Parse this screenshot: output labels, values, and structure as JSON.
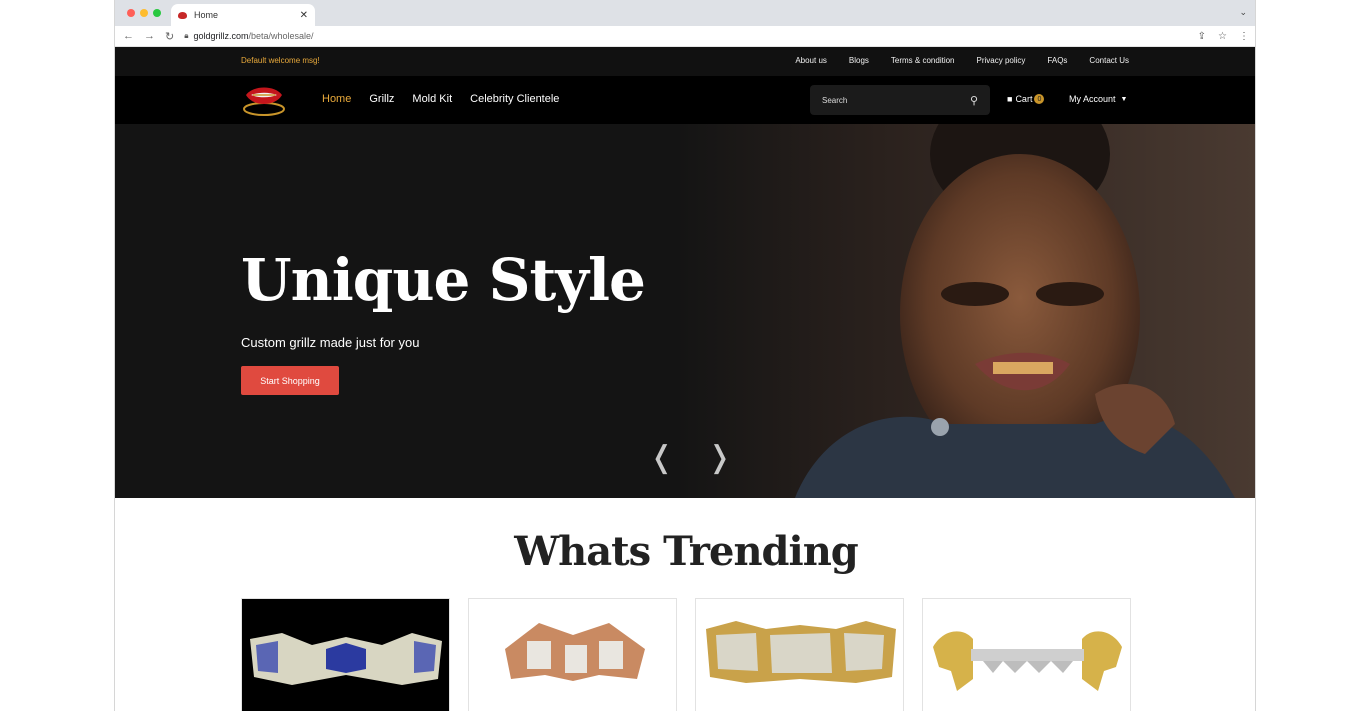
{
  "browser": {
    "tab_title": "Home",
    "url_host": "goldgrillz.com",
    "url_path": "/beta/wholesale/",
    "tab_close": "✕"
  },
  "topbar": {
    "welcome": "Default welcome msg!",
    "links": [
      "About us",
      "Blogs",
      "Terms & condition",
      "Privacy policy",
      "FAQs",
      "Contact Us"
    ]
  },
  "header": {
    "nav": [
      "Home",
      "Grillz",
      "Mold Kit",
      "Celebrity Clientele"
    ],
    "search_placeholder": "Search",
    "cart_label": "Cart",
    "cart_count": "0",
    "account_label": "My Account"
  },
  "hero": {
    "title": "Unique Style",
    "subtitle": "Custom grillz made just for you",
    "cta": "Start Shopping"
  },
  "trending": {
    "title": "Whats Trending"
  },
  "colors": {
    "accent_gold": "#e8a93b",
    "cta_red": "#e04a3f",
    "header_bg": "#000000"
  },
  "icons": [
    "search-icon",
    "cart-icon",
    "caret-down-icon",
    "lock-icon",
    "back-icon",
    "forward-icon",
    "reload-icon",
    "share-icon",
    "star-icon",
    "menu-icon",
    "prev-arrow-icon",
    "next-arrow-icon"
  ]
}
